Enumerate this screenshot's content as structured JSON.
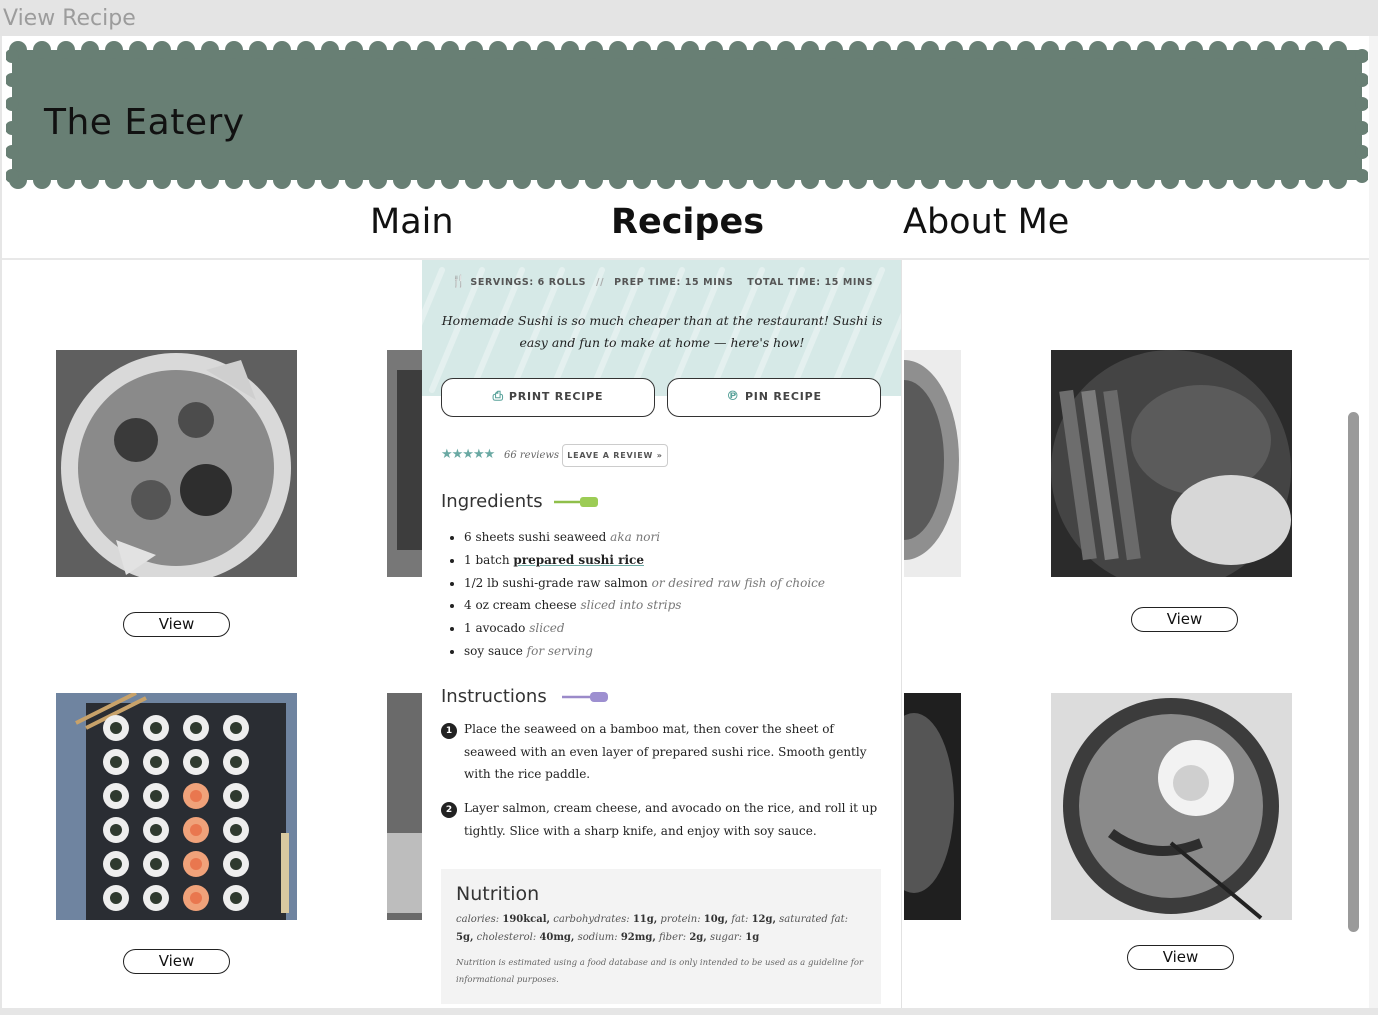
{
  "window": {
    "title": "View Recipe"
  },
  "brand": {
    "name": "The Eatery",
    "banner_color": "#687f74"
  },
  "nav": {
    "main": "Main",
    "recipes": "Recipes",
    "about": "About Me",
    "active": "Recipes"
  },
  "gallery": {
    "view_label": "View"
  },
  "recipe": {
    "servings": "SERVINGS: 6 ROLLS",
    "separator": "//",
    "prep_time": "PREP TIME: 15 MINS",
    "total_time": "TOTAL TIME: 15 MINS",
    "intro": "Homemade Sushi is so much cheaper than at the restaurant! Sushi is easy and fun to make at home — here's how!",
    "print_label": "PRINT RECIPE",
    "pin_label": "PIN RECIPE",
    "rating_stars": "★★★★★",
    "reviews": "66 reviews",
    "leave_review": "LEAVE A REVIEW »",
    "ingredients_title": "Ingredients",
    "ingredients": [
      {
        "main": "6 sheets sushi seaweed",
        "note": "aka nori"
      },
      {
        "prefix": "1 batch",
        "link": "prepared sushi rice"
      },
      {
        "main": "1/2 lb sushi-grade raw salmon",
        "note": "or desired raw fish of choice"
      },
      {
        "main": "4 oz cream cheese",
        "note": "sliced into strips"
      },
      {
        "main": "1 avocado",
        "note": "sliced"
      },
      {
        "main": "soy sauce",
        "note": "for serving"
      }
    ],
    "instructions_title": "Instructions",
    "steps": [
      {
        "num": "1",
        "text": "Place the seaweed on a bamboo mat, then cover the sheet of seaweed with an even layer of prepared sushi rice. Smooth gently with the rice paddle."
      },
      {
        "num": "2",
        "text": "Layer salmon, cream cheese, and avocado on the rice, and roll it up tightly. Slice with a sharp knife, and enjoy with soy sauce."
      }
    ],
    "nutrition_title": "Nutrition",
    "nutrition": {
      "calories_label": "calories:",
      "calories": "190kcal,",
      "carbs_label": "carbohydrates:",
      "carbs": "11g,",
      "protein_label": "protein:",
      "protein": "10g,",
      "fat_label": "fat:",
      "fat": "12g,",
      "sat_fat_label": "saturated fat:",
      "sat_fat": "5g,",
      "cholesterol_label": "cholesterol:",
      "cholesterol": "40mg,",
      "sodium_label": "sodium:",
      "sodium": "92mg,",
      "fiber_label": "fiber:",
      "fiber": "2g,",
      "sugar_label": "sugar:",
      "sugar": "1g"
    },
    "nutrition_note": "Nutrition is estimated using a food database and is only intended to be used as a guideline for informational purposes."
  },
  "icons": [
    "utensils-icon",
    "printer-icon",
    "pinterest-icon",
    "star-icon",
    "spatula-icon"
  ]
}
